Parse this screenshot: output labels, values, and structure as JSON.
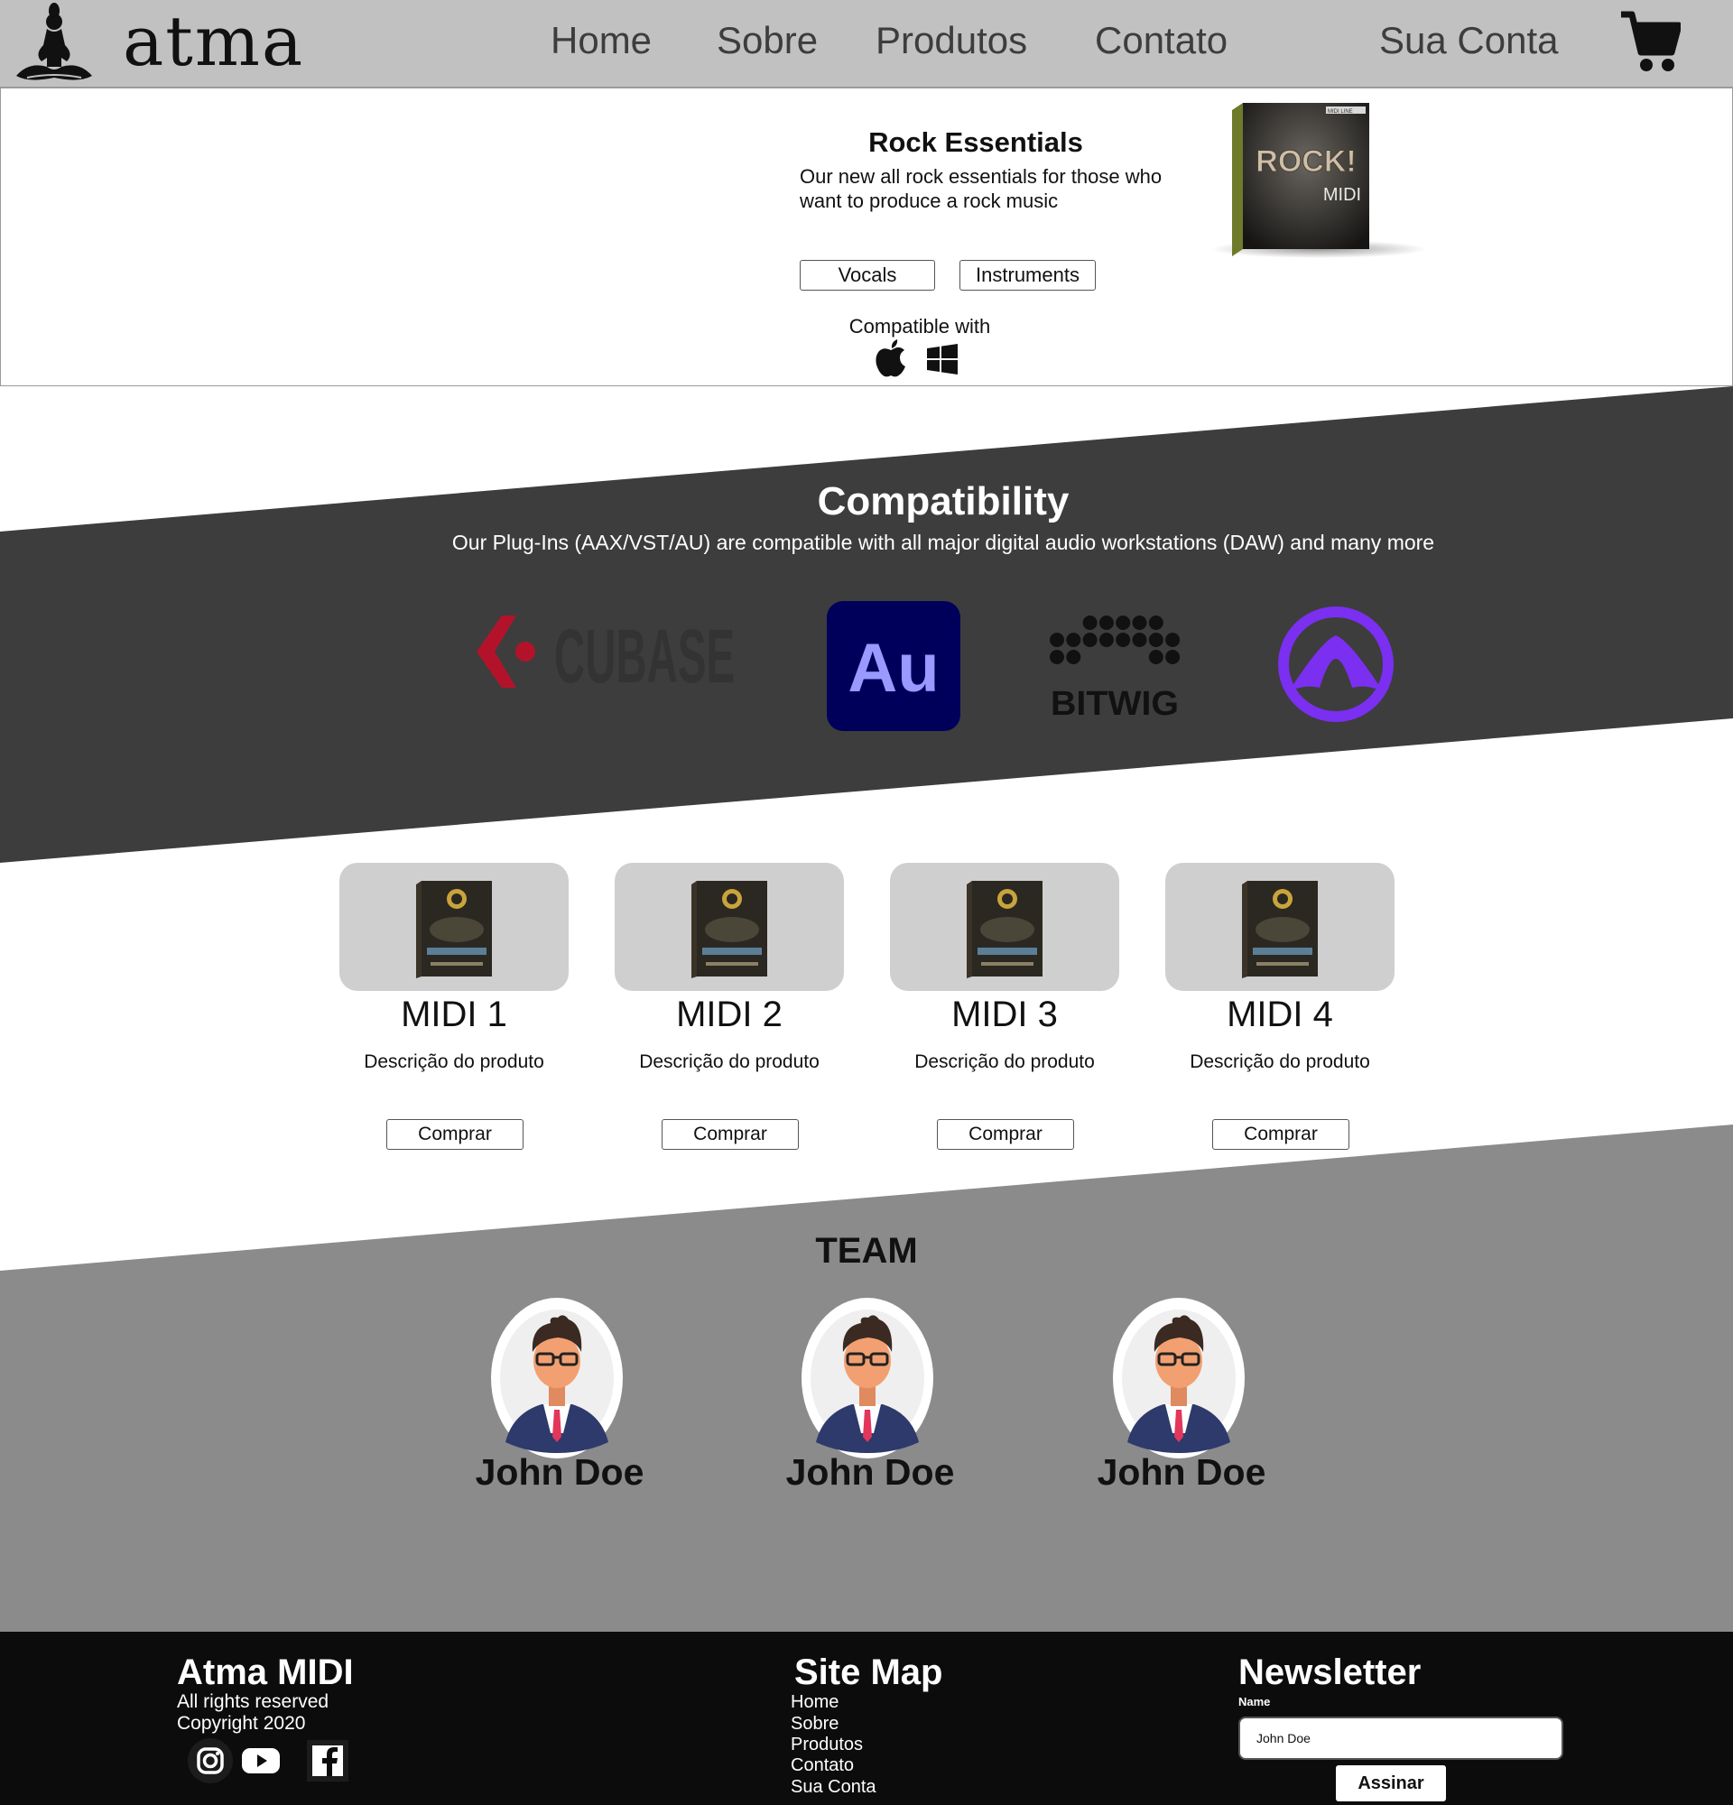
{
  "header": {
    "logo_text": "atma",
    "nav": [
      "Home",
      "Sobre",
      "Produtos",
      "Contato"
    ],
    "account_label": "Sua Conta",
    "icons": {
      "logo": "meditation-figure-icon",
      "cart": "shopping-cart-icon"
    }
  },
  "hero": {
    "title": "Rock Essentials",
    "description": "Our new all rock essentials for those who want to produce a rock music",
    "buttons": [
      "Vocals",
      "Instruments"
    ],
    "compatible_label": "Compatible with",
    "compatible_icons": [
      "apple-icon",
      "windows-icon"
    ],
    "product_box_label": "ROCK!",
    "product_box_sub": "MIDI",
    "product_box_tag": "MIDI LINE"
  },
  "compatibility": {
    "title": "Compatibility",
    "subtitle": "Our Plug-Ins (AAX/VST/AU) are compatible with all major digital audio workstations (DAW) and many more",
    "daws": [
      {
        "name": "CUBASE",
        "icon": "cubase-logo"
      },
      {
        "name": "Au",
        "icon": "adobe-audition-logo"
      },
      {
        "name": "BITWIG",
        "icon": "bitwig-logo"
      },
      {
        "name": "",
        "icon": "pro-tools-logo"
      }
    ],
    "colors": {
      "band": "#3d3d3d",
      "cubase_red": "#b3132a",
      "audition_bg": "#00005b",
      "audition_text": "#9999ff",
      "protools": "#7b2ff0"
    }
  },
  "products": {
    "items": [
      {
        "name": "MIDI 1",
        "description": "Descrição do produto",
        "button": "Comprar"
      },
      {
        "name": "MIDI 2",
        "description": "Descrição do produto",
        "button": "Comprar"
      },
      {
        "name": "MIDI 3",
        "description": "Descrição do produto",
        "button": "Comprar"
      },
      {
        "name": "MIDI 4",
        "description": "Descrição do produto",
        "button": "Comprar"
      }
    ]
  },
  "team": {
    "title": "TEAM",
    "members": [
      {
        "name": "John Doe"
      },
      {
        "name": "John Doe"
      },
      {
        "name": "John Doe"
      }
    ]
  },
  "footer": {
    "brand": "Atma MIDI",
    "rights": "All rights reserved",
    "copyright": "Copyright 2020",
    "social_icons": [
      "instagram-icon",
      "youtube-icon",
      "facebook-icon"
    ],
    "sitemap_title": "Site Map",
    "sitemap_links": [
      "Home",
      "Sobre",
      "Produtos",
      "Contato",
      "Sua Conta"
    ],
    "newsletter_title": "Newsletter",
    "name_label": "Name",
    "name_value": "John Doe",
    "submit_label": "Assinar"
  }
}
